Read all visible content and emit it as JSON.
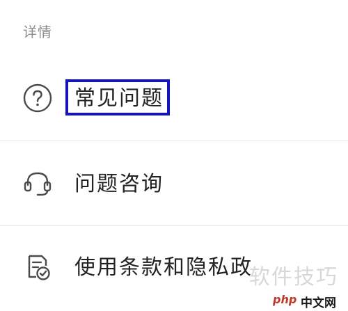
{
  "section": {
    "title": "详情"
  },
  "items": [
    {
      "label": "常见问题",
      "icon": "question-circle-icon"
    },
    {
      "label": "问题咨询",
      "icon": "headset-icon"
    },
    {
      "label": "使用条款和隐私政",
      "icon": "document-check-icon"
    }
  ],
  "highlight": {
    "color": "#1414b8"
  },
  "watermark": {
    "text": "软件技巧",
    "logo_php": "php",
    "logo_zh": "中文网"
  }
}
